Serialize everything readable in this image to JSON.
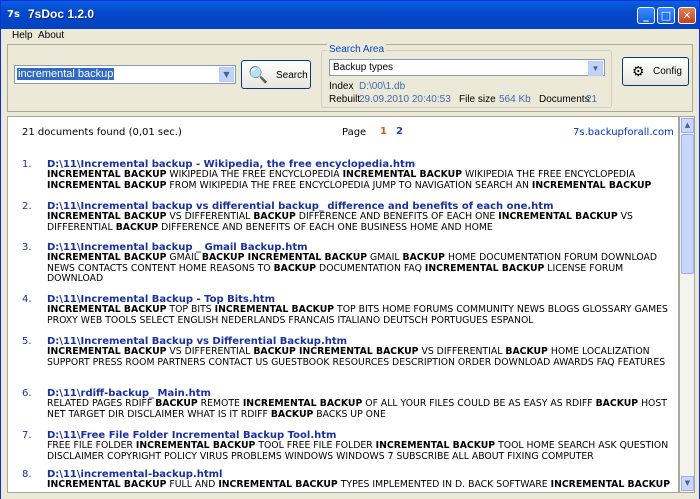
{
  "window": {
    "title": "7sDoc 1.2.0",
    "icon": "app-icon"
  },
  "menu": [
    {
      "label": "Help"
    },
    {
      "label": "About"
    }
  ],
  "query": {
    "value": "incremental backup"
  },
  "search_button": {
    "label": "Search"
  },
  "search_area": {
    "label": "Search Area",
    "selected": "Backup types",
    "index_label": "Index",
    "index_value": "D:\\00\\1.db",
    "rebuilt_label": "Rebuilt",
    "rebuilt_value": "29.09.2010 20:40:53",
    "filesize_label": "File size",
    "filesize_value": "564 Kb",
    "documents_label": "Documents",
    "documents_value": "21"
  },
  "config_button": {
    "label": "Config"
  },
  "results_header": {
    "found": "21 documents found (0,01 sec.)",
    "page_label": "Page",
    "pages": [
      "1",
      "2"
    ],
    "site": "7s.backupforall.com"
  },
  "results": [
    {
      "num": "1.",
      "link": "D:\\11\\Incremental backup - Wikipedia, the free encyclopedia.htm",
      "snippet": "<b>INCREMENTAL BACKUP</b> WIKIPEDIA THE FREE ENCYCLOPEDIA <b>INCREMENTAL BACKUP</b> WIKIPEDIA THE FREE ENCYCLOPEDIA <b>INCREMENTAL BACKUP</b> FROM WIKIPEDIA THE FREE ENCYCLOPEDIA JUMP TO NAVIGATION SEARCH AN <b>INCREMENTAL BACKUP</b>"
    },
    {
      "num": "2.",
      "link": "D:\\11\\Incremental backup vs differential backup_ difference and benefits of each one.htm",
      "snippet": "<b>INCREMENTAL BACKUP</b> VS DIFFERENTIAL <b>BACKUP</b> DIFFERENCE AND BENEFITS OF EACH ONE <b>INCREMENTAL BACKUP</b> VS DIFFERENTIAL <b>BACKUP</b> DIFFERENCE AND BENEFITS OF EACH ONE BUSINESS HOME AND HOME"
    },
    {
      "num": "3.",
      "link": "D:\\11\\Incremental backup _ Gmail Backup.htm",
      "snippet": "<b>INCREMENTAL BACKUP</b> GMAIL <b>BACKUP INCREMENTAL BACKUP</b> GMAIL <b>BACKUP</b> HOME DOCUMENTATION FORUM DOWNLOAD NEWS CONTACTS CONTENT HOME REASONS TO <b>BACKUP</b> DOCUMENTATION FAQ <b>INCREMENTAL BACKUP</b> LICENSE FORUM DOWNLOAD"
    },
    {
      "num": "4.",
      "link": "D:\\11\\Incremental Backup - Top Bits.htm",
      "snippet": "<b>INCREMENTAL BACKUP</b> TOP BITS <b>INCREMENTAL BACKUP</b> TOP BITS HOME FORUMS COMMUNITY NEWS BLOGS GLOSSARY GAMES PROXY WEB TOOLS SELECT ENGLISH NEDERLANDS FRANCAIS ITALIANO DEUTSCH PORTUGUES ESPANOL"
    },
    {
      "num": "5.",
      "link": "D:\\11\\Incremental Backup vs Differential Backup.htm",
      "snippet": "<b>INCREMENTAL BACKUP</b> VS DIFFERENTIAL <b>BACKUP INCREMENTAL BACKUP</b> VS DIFFERENTIAL <b>BACKUP</b> HOME LOCALIZATION SUPPORT PRESS ROOM PARTNERS CONTACT US GUESTBOOK RESOURCES DESCRIPTION ORDER DOWNLOAD AWARDS FAQ FEATURES"
    },
    {
      "num": "6.",
      "link": "D:\\11\\rdiff-backup_ Main.htm",
      "snippet": "RELATED PAGES RDIFF <b>BACKUP</b> REMOTE <b>INCREMENTAL BACKUP</b> OF ALL YOUR FILES COULD BE AS EASY AS RDIFF <b>BACKUP</b> HOST NET TARGET DIR DISCLAIMER WHAT IS IT RDIFF <b>BACKUP</b> BACKS UP ONE"
    },
    {
      "num": "7.",
      "link": "D:\\11\\Free File Folder Incremental Backup Tool.htm",
      "snippet": "FREE FILE FOLDER <b>INCREMENTAL BACKUP</b> TOOL FREE FILE FOLDER <b>INCREMENTAL BACKUP</b> TOOL HOME SEARCH ASK QUESTION DISCLAIMER COPYRIGHT POLICY VIRUS PROBLEMS WINDOWS WINDOWS 7 SUBSCRIBE ALL ABOUT FIXING COMPUTER"
    },
    {
      "num": "8.",
      "link": "D:\\11\\incremental-backup.html",
      "snippet": "<b>INCREMENTAL BACKUP</b> FULL AND <b>INCREMENTAL BACKUP</b> TYPES IMPLEMENTED IN D. BACK SOFTWARE <b>INCREMENTAL BACKUP</b>"
    }
  ]
}
